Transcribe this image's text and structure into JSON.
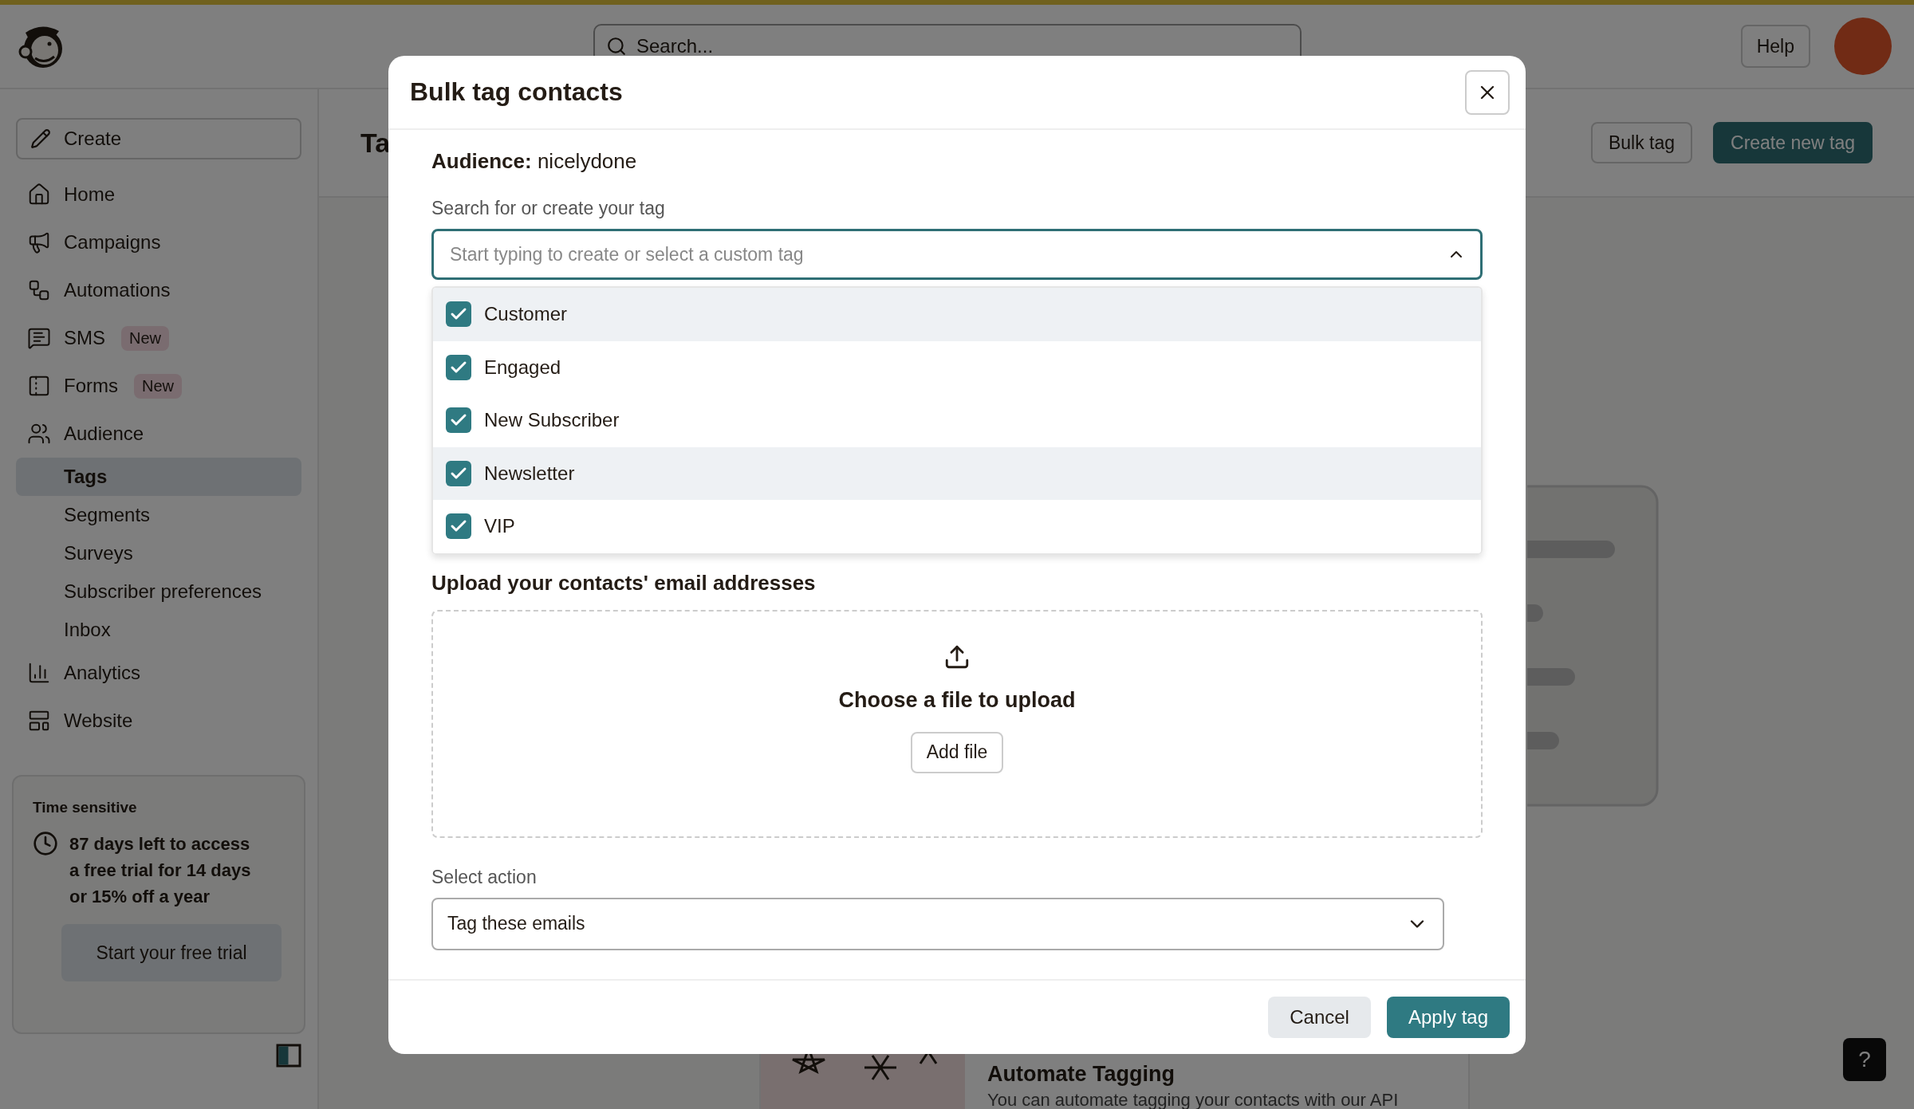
{
  "top_bar": {
    "search_placeholder": "Search...",
    "help": "Help"
  },
  "sidebar": {
    "create": "Create",
    "items": [
      {
        "kind": "nav",
        "label": "Home",
        "selected": false
      },
      {
        "kind": "nav",
        "label": "Campaigns",
        "selected": false
      },
      {
        "kind": "nav",
        "label": "Automations",
        "selected": false
      },
      {
        "kind": "nav",
        "label": "SMS",
        "badge": "New",
        "selected": false
      },
      {
        "kind": "nav",
        "label": "Forms",
        "badge": "New",
        "selected": false
      },
      {
        "kind": "nav",
        "label": "Audience",
        "selected": false
      },
      {
        "kind": "sub",
        "label": "Tags",
        "selected": true
      },
      {
        "kind": "sub",
        "label": "Segments",
        "selected": false
      },
      {
        "kind": "sub",
        "label": "Surveys",
        "selected": false
      },
      {
        "kind": "sub",
        "label": "Subscriber preferences",
        "selected": false
      },
      {
        "kind": "sub",
        "label": "Inbox",
        "selected": false
      },
      {
        "kind": "nav",
        "label": "Analytics",
        "selected": false
      },
      {
        "kind": "nav",
        "label": "Website",
        "selected": false
      }
    ],
    "trial": {
      "title": "Time sensitive",
      "text": "87 days left to access a free trial for 14 days or 15% off a year",
      "button": "Start your free trial"
    }
  },
  "page": {
    "title": "Ta",
    "buttons": [
      {
        "label": "Bulk tag",
        "kind": "secondary"
      },
      {
        "label": "Create new tag",
        "kind": "primary"
      }
    ],
    "promo": {
      "title": "Automate Tagging",
      "text": "You can automate tagging your contacts with our API"
    },
    "help_button": "?"
  },
  "modal": {
    "title": "Bulk tag contacts",
    "audience": "**Audience:** nicelydone",
    "search_label": "Search for or create your tag",
    "search_placeholder": "Start typing to create or select a custom tag",
    "tags": [
      {
        "label": "Customer",
        "checked": true,
        "selected": true
      },
      {
        "label": "Engaged",
        "checked": true,
        "selected": false
      },
      {
        "label": "New Subscriber",
        "checked": true,
        "selected": false
      },
      {
        "label": "Newsletter",
        "checked": true,
        "selected": true
      },
      {
        "label": "VIP",
        "checked": true,
        "selected": false
      }
    ],
    "upload_title": "Upload your contacts' email addresses",
    "upload_text": "Choose a file to upload",
    "add_file": "Add file",
    "action_label": "Select action",
    "action_value": "Tag these emails",
    "buttons": [
      {
        "label": "Cancel",
        "kind": "secondary"
      },
      {
        "label": "Apply tag",
        "kind": "primary"
      }
    ]
  }
}
